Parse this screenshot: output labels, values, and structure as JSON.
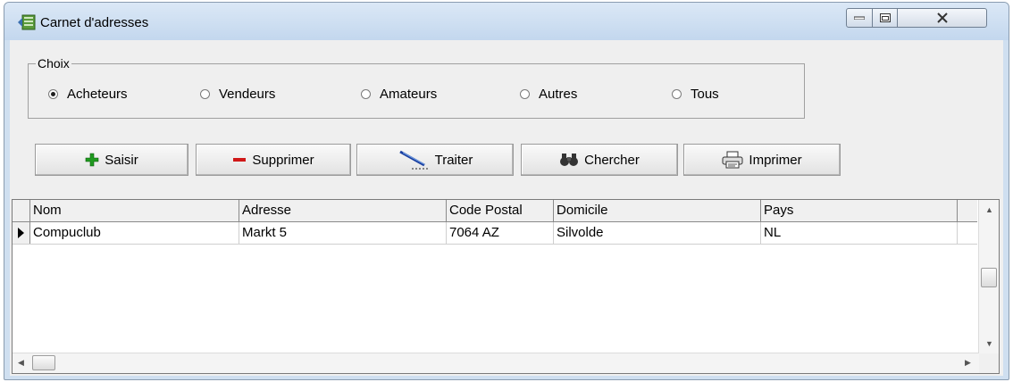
{
  "window": {
    "title": "Carnet d'adresses",
    "icon": "address-book-icon"
  },
  "choix": {
    "legend": "Choix",
    "options": [
      {
        "label": "Acheteurs",
        "checked": true
      },
      {
        "label": "Vendeurs",
        "checked": false
      },
      {
        "label": "Amateurs",
        "checked": false
      },
      {
        "label": "Autres",
        "checked": false
      },
      {
        "label": "Tous",
        "checked": false
      }
    ]
  },
  "toolbar": {
    "saisir": "Saisir",
    "supprimer": "Supprimer",
    "traiter": "Traiter",
    "chercher": "Chercher",
    "imprimer": "Imprimer"
  },
  "grid": {
    "columns": [
      "Nom",
      "Adresse",
      "Code Postal",
      "Domicile",
      "Pays"
    ],
    "rows": [
      [
        "Compuclub",
        "Markt 5",
        "7064 AZ",
        "Silvolde",
        "NL"
      ]
    ]
  },
  "colors": {
    "plus": "#1f9a1f",
    "minus": "#d01818",
    "titlebar": "#c3d7ee"
  }
}
